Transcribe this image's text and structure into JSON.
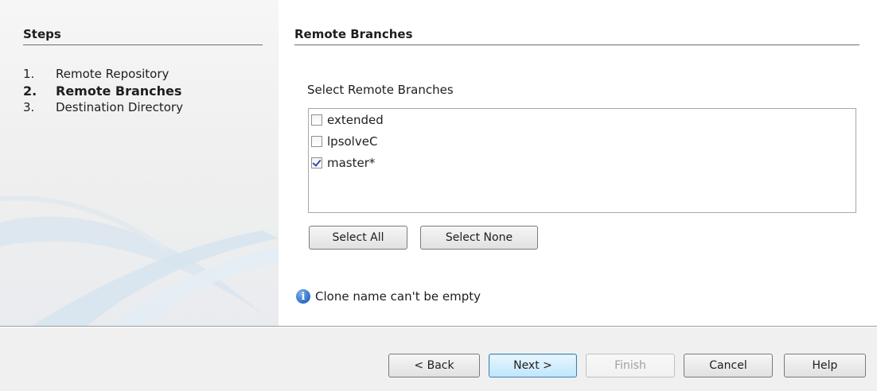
{
  "steps": {
    "title": "Steps",
    "items": [
      {
        "num": "1.",
        "label": "Remote Repository"
      },
      {
        "num": "2.",
        "label": "Remote Branches"
      },
      {
        "num": "3.",
        "label": "Destination Directory"
      }
    ],
    "current_index": 1
  },
  "main": {
    "title": "Remote Branches",
    "select_label": "Select Remote Branches",
    "branches": [
      {
        "name": "extended",
        "checked": false
      },
      {
        "name": "lpsolveC",
        "checked": false
      },
      {
        "name": "master*",
        "checked": true
      }
    ],
    "select_all_label": "Select All",
    "select_none_label": "Select None",
    "info_message": "Clone name can't be empty"
  },
  "footer": {
    "back_label": "< Back",
    "next_label": "Next >",
    "finish_label": "Finish",
    "cancel_label": "Cancel",
    "help_label": "Help"
  },
  "colors": {
    "accent": "#3c7fb1",
    "info": "#2c6cc4"
  }
}
